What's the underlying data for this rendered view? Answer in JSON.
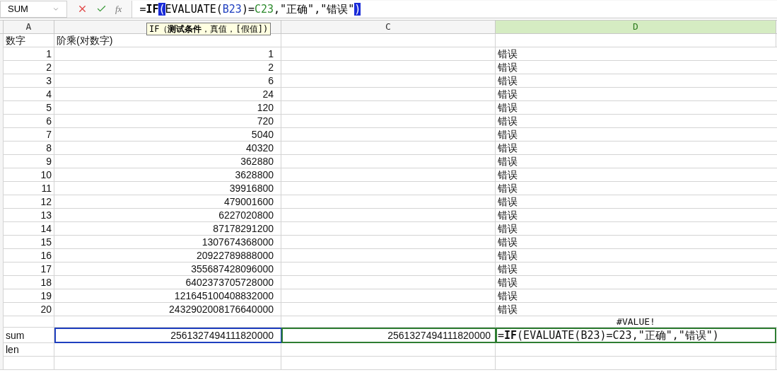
{
  "formula_bar": {
    "name_box": "SUM",
    "function_label": "fx",
    "segments": [
      {
        "text": "=",
        "kind": "plain"
      },
      {
        "text": "IF",
        "kind": "bold"
      },
      {
        "text": "(",
        "kind": "bracket"
      },
      {
        "text": "EVALUATE(",
        "kind": "plain"
      },
      {
        "text": "B23",
        "kind": "ref",
        "color": "#1f3fbf"
      },
      {
        "text": ")=",
        "kind": "plain"
      },
      {
        "text": "C23",
        "kind": "ref",
        "color": "#2e8b2e"
      },
      {
        "text": ",\"正确\",\"错误\"",
        "kind": "plain"
      },
      {
        "text": ")",
        "kind": "bracket"
      }
    ]
  },
  "tooltip": "IF（**测试条件**，真值，[假值])",
  "columns": [
    {
      "label": "A",
      "selected": false
    },
    {
      "selected": false
    },
    {
      "label": "C",
      "selected": false
    },
    {
      "label": "D",
      "selected": true
    }
  ],
  "rows": [
    {
      "kind": "header",
      "a": "数字",
      "b": "阶乘(对数字)"
    },
    {
      "kind": "data",
      "a": "1",
      "b": "1",
      "d": "错误"
    },
    {
      "kind": "data",
      "a": "2",
      "b": "2",
      "d": "错误"
    },
    {
      "kind": "data",
      "a": "3",
      "b": "6",
      "d": "错误"
    },
    {
      "kind": "data",
      "a": "4",
      "b": "24",
      "d": "错误"
    },
    {
      "kind": "data",
      "a": "5",
      "b": "120",
      "d": "错误"
    },
    {
      "kind": "data",
      "a": "6",
      "b": "720",
      "d": "错误"
    },
    {
      "kind": "data",
      "a": "7",
      "b": "5040",
      "d": "错误"
    },
    {
      "kind": "data",
      "a": "8",
      "b": "40320",
      "d": "错误"
    },
    {
      "kind": "data",
      "a": "9",
      "b": "362880",
      "d": "错误"
    },
    {
      "kind": "data",
      "a": "10",
      "b": "3628800",
      "d": "错误"
    },
    {
      "kind": "data",
      "a": "11",
      "b": "39916800",
      "d": "错误"
    },
    {
      "kind": "data",
      "a": "12",
      "b": "479001600",
      "d": "错误"
    },
    {
      "kind": "data",
      "a": "13",
      "b": "6227020800",
      "d": "错误"
    },
    {
      "kind": "data",
      "a": "14",
      "b": "87178291200",
      "d": "错误"
    },
    {
      "kind": "data",
      "a": "15",
      "b": "1307674368000",
      "d": "错误"
    },
    {
      "kind": "data",
      "a": "16",
      "b": "20922789888000",
      "d": "错误"
    },
    {
      "kind": "data",
      "a": "17",
      "b": "355687428096000",
      "d": "错误"
    },
    {
      "kind": "data",
      "a": "18",
      "b": "6402373705728000",
      "d": "错误"
    },
    {
      "kind": "data",
      "a": "19",
      "b": "121645100408832000",
      "d": "错误"
    },
    {
      "kind": "data",
      "a": "20",
      "b": "2432902008176640000",
      "d": "错误"
    },
    {
      "kind": "note",
      "d": "#VALUE!"
    },
    {
      "kind": "total",
      "a": "sum",
      "cells": [
        {
          "text": "2561327494111820000",
          "color": "#1f3fbf"
        },
        {
          "text": "2561327494111820000",
          "color": "#2e7d32"
        },
        {
          "text": "=**IF**(EVALUATE(B23)=C23,\"正确\",\"错误\")",
          "color": "#2e7d32"
        }
      ]
    },
    {
      "kind": "label",
      "a": "len"
    },
    {
      "kind": "label"
    }
  ]
}
